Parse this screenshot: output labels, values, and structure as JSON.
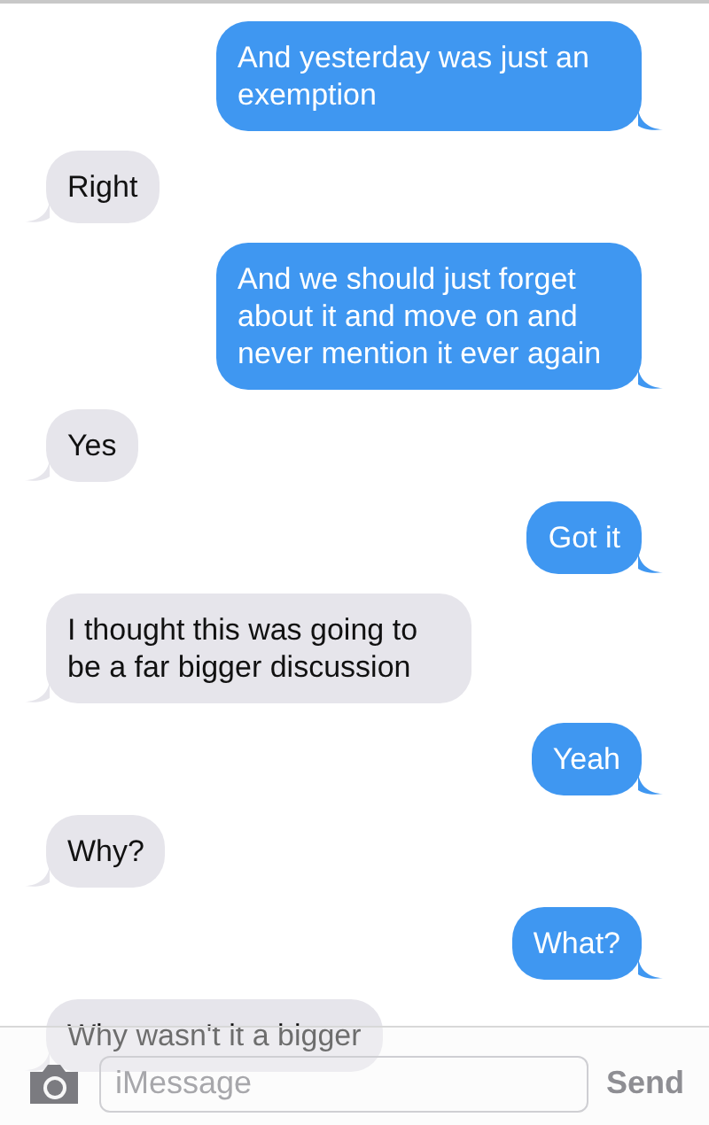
{
  "messages": [
    {
      "kind": "sent",
      "text": "And yesterday was just an exemption"
    },
    {
      "kind": "received",
      "text": "Right"
    },
    {
      "kind": "sent",
      "text": "And we should just forget about it and move on and never mention it ever again"
    },
    {
      "kind": "received",
      "text": "Yes"
    },
    {
      "kind": "sent",
      "text": "Got it"
    },
    {
      "kind": "received",
      "text": "I thought this was going to be a far bigger discussion"
    },
    {
      "kind": "sent",
      "text": "Yeah"
    },
    {
      "kind": "received",
      "text": "Why?"
    },
    {
      "kind": "sent",
      "text": "What?"
    },
    {
      "kind": "received",
      "text": "Why wasn't it a bigger"
    }
  ],
  "composer": {
    "placeholder": "iMessage",
    "send_label": "Send"
  }
}
